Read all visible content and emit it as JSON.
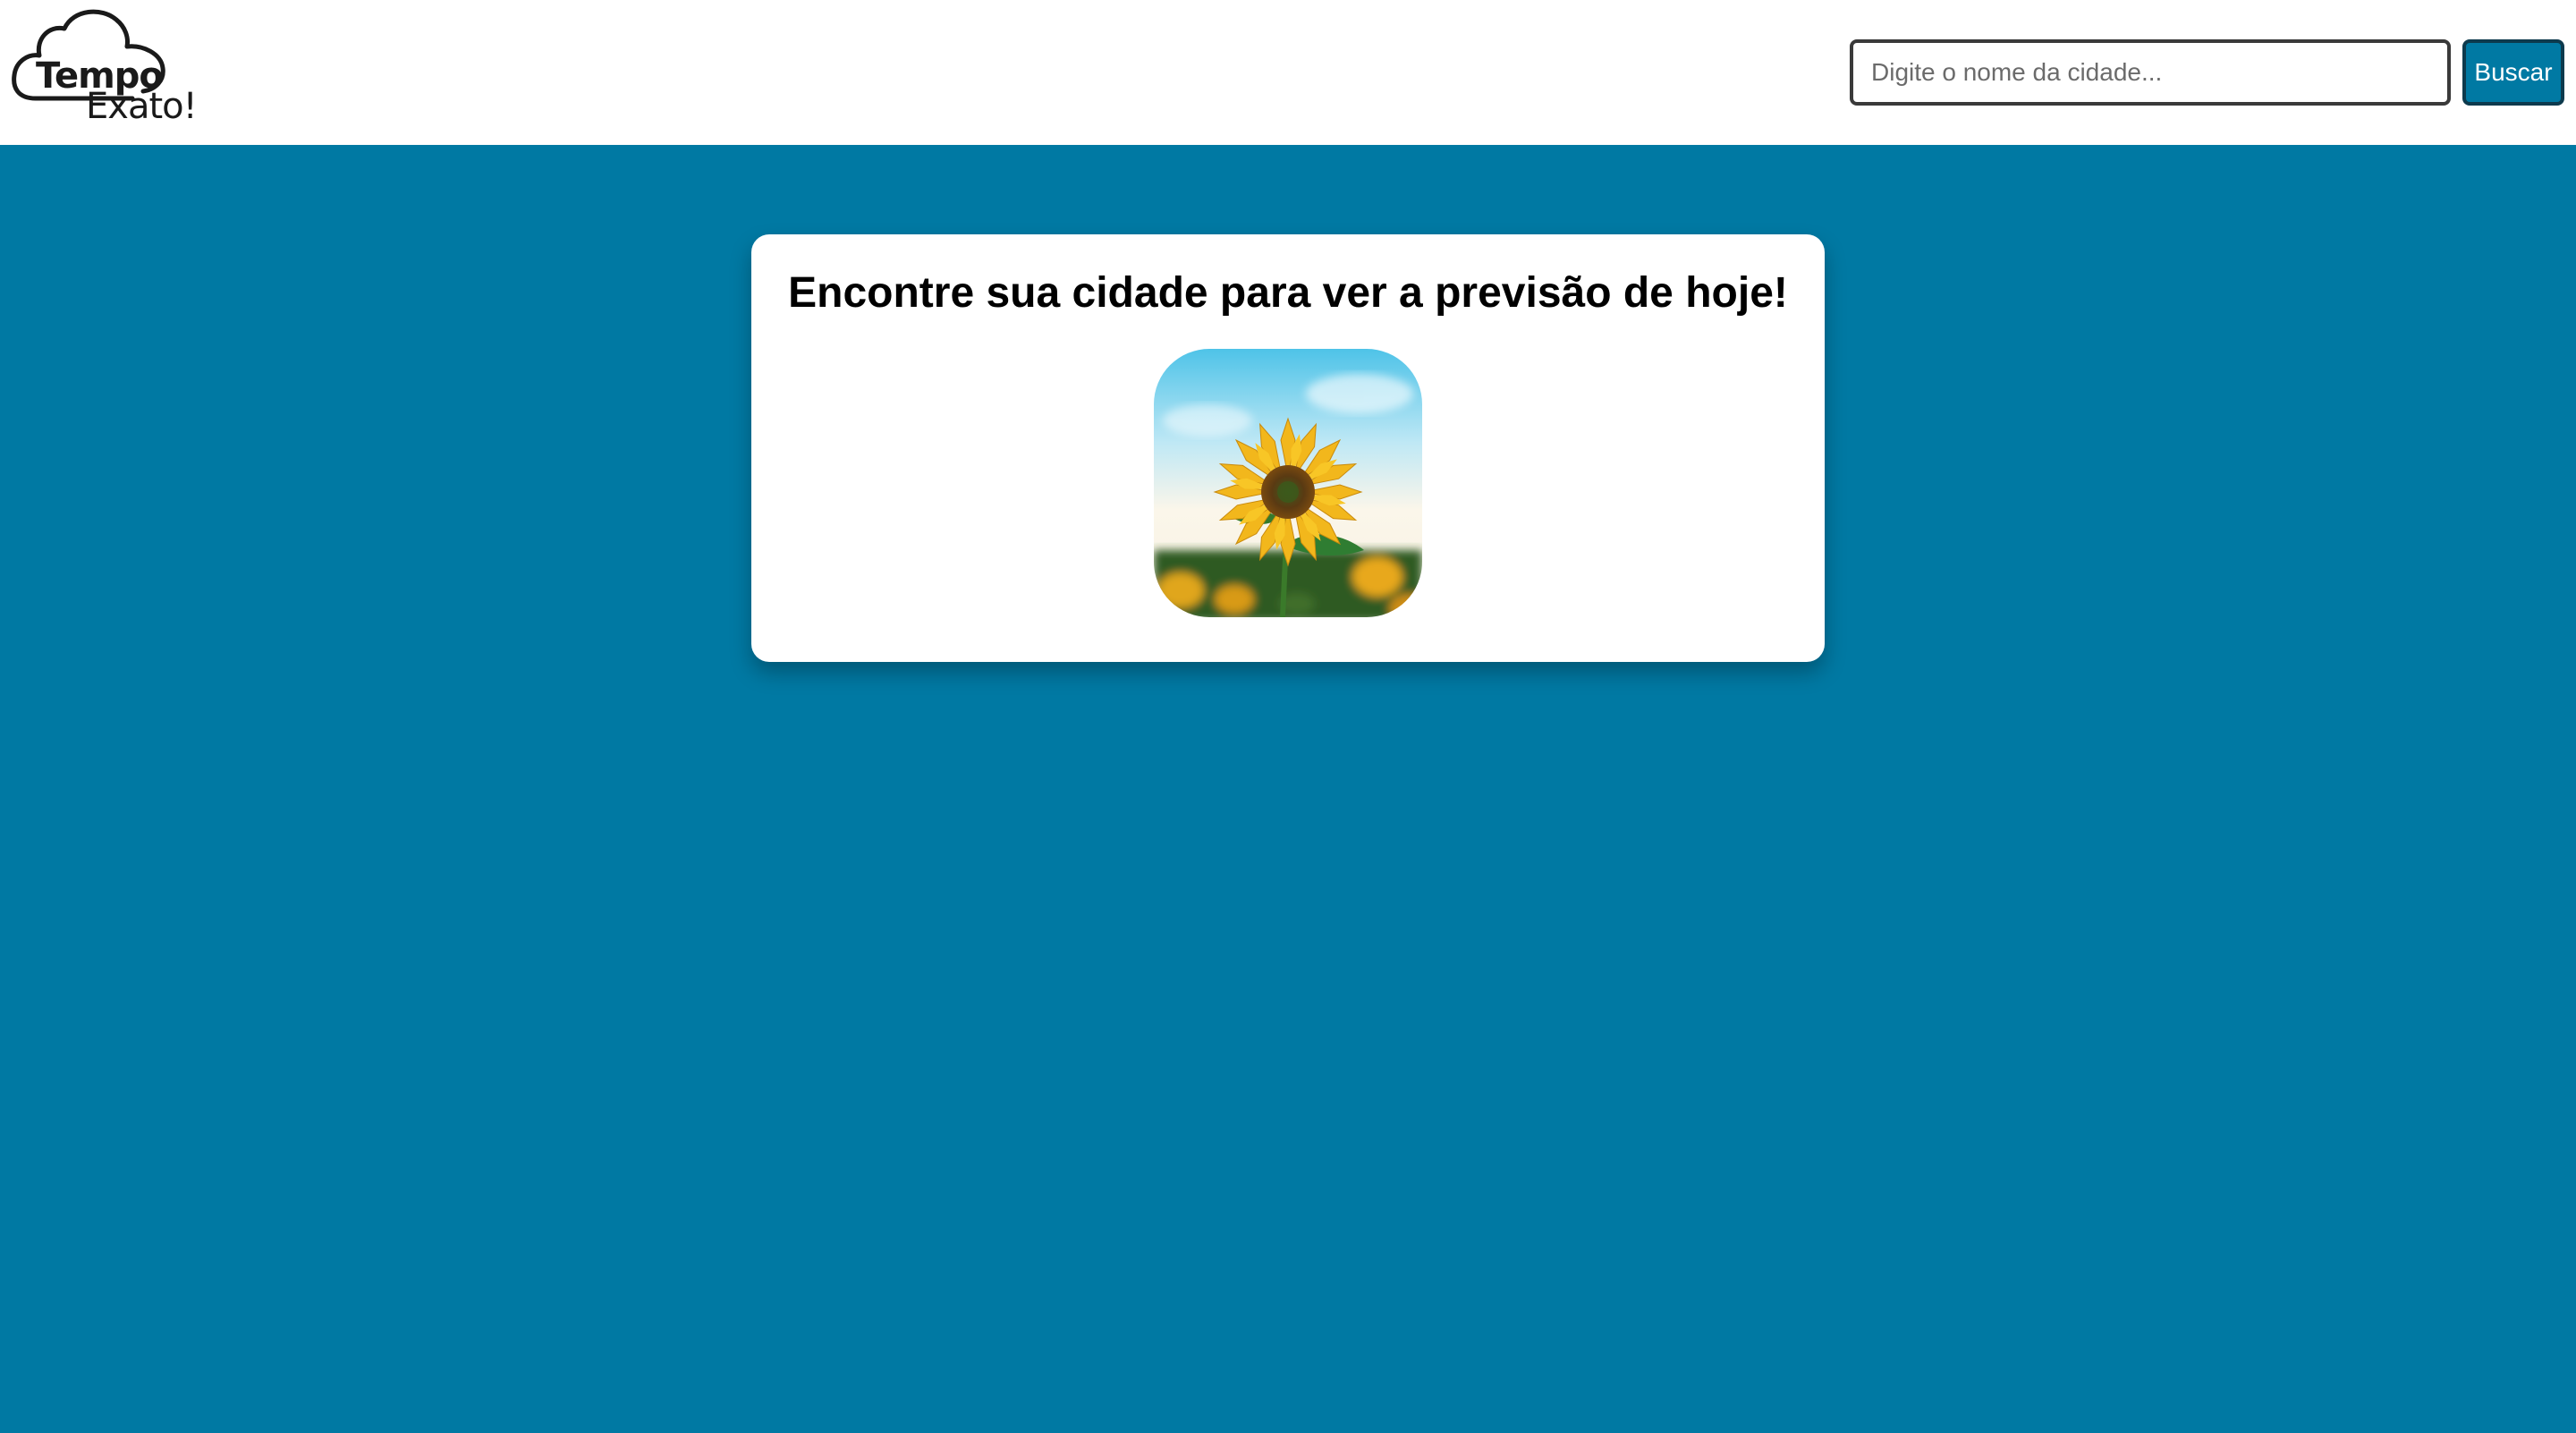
{
  "header": {
    "logo": {
      "line1": "Tempo",
      "line2": "Exato!"
    },
    "search": {
      "placeholder": "Digite o nome da cidade...",
      "value": ""
    },
    "search_button_label": "Buscar"
  },
  "main": {
    "card_title": "Encontre sua cidade para ver a previsão de hoje!",
    "image_icon": "sunflower-photo"
  },
  "colors": {
    "background": "#0079a3",
    "header_background": "#ffffff",
    "button_background": "#0079a3",
    "card_background": "#ffffff"
  }
}
